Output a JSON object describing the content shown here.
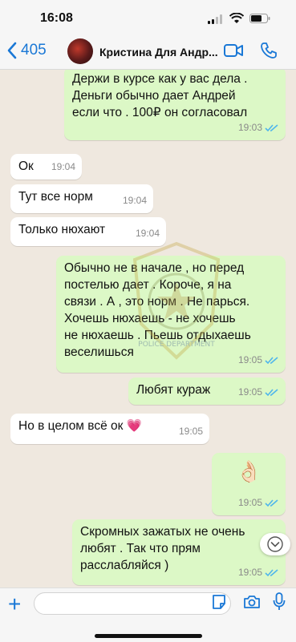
{
  "status": {
    "time": "16:08"
  },
  "header": {
    "back_count": "405",
    "contact_name": "Кристина Для Андр..."
  },
  "messages": [
    {
      "dir": "out",
      "text": "Держи в курсе как у вас дела .\nДеньги обычно дает Андрей\nесли что . 100₽ он согласовал",
      "time": "19:03",
      "read": true
    },
    {
      "dir": "in",
      "text": "Ок",
      "time": "19:04"
    },
    {
      "dir": "in",
      "text": "Тут все норм",
      "time": "19:04"
    },
    {
      "dir": "in",
      "text": "Только нюхают",
      "time": "19:04"
    },
    {
      "dir": "out",
      "text": "Обычно не в начале , но перед\nпостелью дает . Короче, я на\nсвязи . А , это норм . Не парься.\nХочешь нюхаешь - не хочешь\nне нюхаешь . Пьешь отдыхаешь\nвеселишься",
      "time": "19:05",
      "read": true
    },
    {
      "dir": "out",
      "text": "Любят кураж",
      "time": "19:05",
      "read": true
    },
    {
      "dir": "in",
      "text": "Но в целом всё ок 💗",
      "time": "19:05"
    },
    {
      "dir": "out",
      "text": "👌🏻",
      "time": "19:05",
      "read": true
    },
    {
      "dir": "out",
      "text": "Скромных зажатых не очень\nлюбят . Так что прям\nрасслабляйся )",
      "time": "19:05",
      "read": true
    }
  ],
  "watermark": {
    "text": "POLICE DEPARTMENT"
  },
  "colors": {
    "accent": "#1a78d6",
    "outgoing": "#dcf8c6",
    "incoming": "#ffffff",
    "read_ticks": "#4fb6ec"
  },
  "icons": [
    "chevron-left-icon",
    "video-call-icon",
    "phone-icon",
    "plus-icon",
    "sticker-icon",
    "camera-icon",
    "mic-icon",
    "chevron-down-icon"
  ]
}
